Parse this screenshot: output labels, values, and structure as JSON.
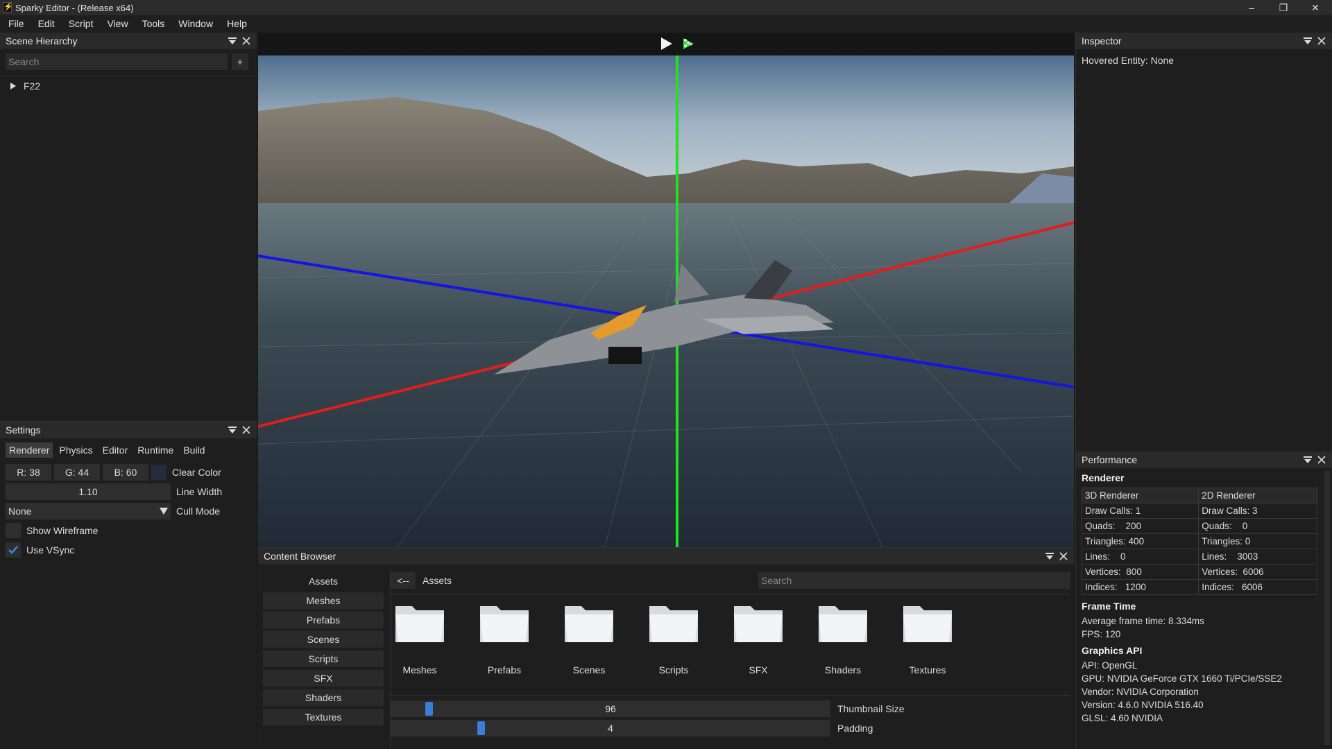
{
  "window": {
    "title": "Sparky Editor - (Release x64)",
    "logo_glyph": "⚡",
    "minimize": "–",
    "restore": "❐",
    "close": "✕"
  },
  "menu": [
    "File",
    "Edit",
    "Script",
    "View",
    "Tools",
    "Window",
    "Help"
  ],
  "scene_hierarchy": {
    "title": "Scene Hierarchy",
    "search_placeholder": "Search",
    "add_label": "+",
    "entity": "F22"
  },
  "settings": {
    "title": "Settings",
    "tabs": [
      "Renderer",
      "Physics",
      "Editor",
      "Runtime",
      "Build"
    ],
    "clear_color": {
      "r": "R: 38",
      "g": "G: 44",
      "b": "B: 60",
      "label": "Clear Color",
      "swatch": "#262c3c"
    },
    "line_width": {
      "value": "1.10",
      "label": "Line Width"
    },
    "cull_mode": {
      "value": "None",
      "label": "Cull Mode"
    },
    "show_wireframe": {
      "label": "Show Wireframe",
      "checked": false
    },
    "use_vsync": {
      "label": "Use VSync",
      "checked": true
    }
  },
  "toolbar": {
    "play_icon": "play-icon",
    "simulate_icon": "simulate-icon"
  },
  "inspector": {
    "title": "Inspector",
    "hovered": "Hovered Entity: None"
  },
  "performance": {
    "title": "Performance",
    "renderer_heading": "Renderer",
    "col_3d": "3D Renderer",
    "col_2d": "2D Renderer",
    "rows": [
      {
        "k": "Draw Calls:",
        "v3": "1",
        "v2": "3"
      },
      {
        "k": "Quads:",
        "v3": "200",
        "v2": "0"
      },
      {
        "k": "Triangles:",
        "v3": "400",
        "v2": "0"
      },
      {
        "k": "Lines:",
        "v3": "0",
        "v2": "3003"
      },
      {
        "k": "Vertices:",
        "v3": "800",
        "v2": "6006"
      },
      {
        "k": "Indices:",
        "v3": "1200",
        "v2": "6006"
      }
    ],
    "frame_heading": "Frame Time",
    "avg_frame": "Average frame time: 8.334ms",
    "fps": "FPS:  120",
    "api_heading": "Graphics API",
    "api": "API:     OpenGL",
    "gpu": "GPU:     NVIDIA GeForce GTX 1660 Ti/PCIe/SSE2",
    "vendor": "Vendor:  NVIDIA Corporation",
    "version": "Version: 4.6.0 NVIDIA 516.40",
    "glsl": "GLSL:    4.60 NVIDIA"
  },
  "content_browser": {
    "title": "Content Browser",
    "root": "Assets",
    "back": "<--",
    "path": "Assets",
    "search_placeholder": "Search",
    "sidebar": [
      "Meshes",
      "Prefabs",
      "Scenes",
      "Scripts",
      "SFX",
      "Shaders",
      "Textures"
    ],
    "folders": [
      "Meshes",
      "Prefabs",
      "Scenes",
      "Scripts",
      "SFX",
      "Shaders",
      "Textures"
    ],
    "thumbnail_size": {
      "value": "96",
      "label": "Thumbnail Size",
      "fraction": 0.08
    },
    "padding": {
      "value": "4",
      "label": "Padding",
      "fraction": 0.2
    }
  },
  "colors": {
    "axis_x": "#e81b1b",
    "axis_y": "#22e022",
    "axis_z": "#1414e6",
    "accent": "#3b7dd8"
  }
}
